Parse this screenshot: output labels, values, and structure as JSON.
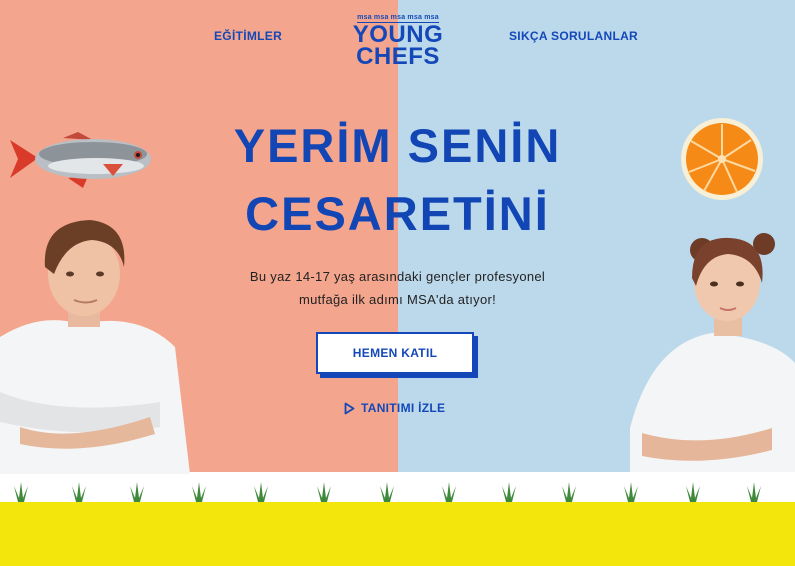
{
  "nav": {
    "left_link": "EĞİTİMLER",
    "right_link": "SIKÇA SORULANLAR"
  },
  "logo": {
    "top_text": "msa msa msa msa msa",
    "line1": "YOUNG",
    "line2": "CHEFS"
  },
  "hero": {
    "headline_line1": "YERİM SENİN",
    "headline_line2": "CESARETİNİ",
    "subtitle_line1": "Bu yaz 14-17 yaş arasındaki gençler profesyonel",
    "subtitle_line2": "mutfağa ilk adımı MSA'da atıyor!",
    "cta_label": "HEMEN KATIL",
    "video_label": "TANITIMI İZLE"
  },
  "colors": {
    "brand_blue": "#1448b8",
    "left_bg": "#f4a58d",
    "right_bg": "#bcd9ec",
    "bottom_band": "#f2e60c"
  },
  "icons": {
    "play": "play-icon"
  }
}
